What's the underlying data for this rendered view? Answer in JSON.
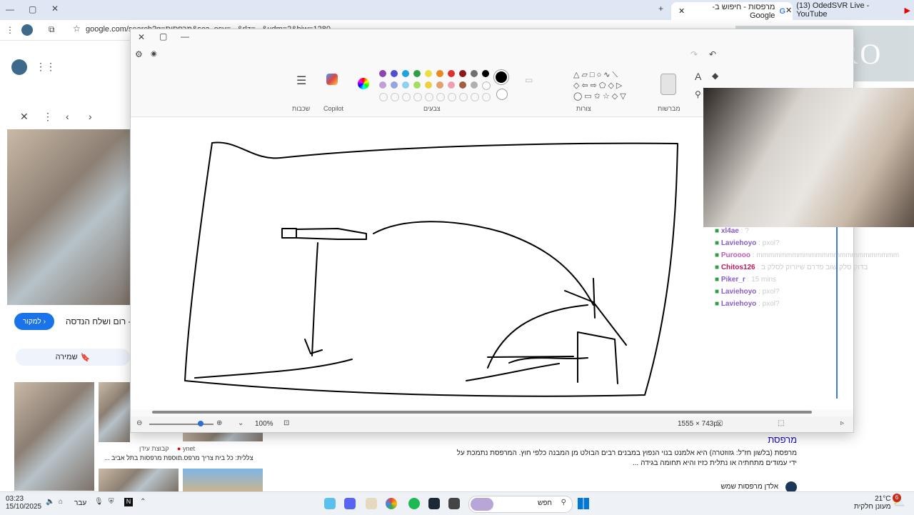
{
  "browser": {
    "tabs": [
      {
        "title": "(13) OdedSVR Live - YouTube"
      },
      {
        "title": "מרפסות - חיפוש ב-Google"
      }
    ],
    "url": "google.com/search?q=מרפסות&sca_esv=...&rlz=...&udm=2&biw=1280"
  },
  "google": {
    "source_button": "למקור",
    "result_title": "- רום ושלח הנדסה",
    "save_button": "שמירה",
    "thumb_captions": [
      {
        "source": "ynet",
        "caption": "צללית: כל בית צריך מרפס..."
      },
      {
        "source": "קבוצת עידן",
        "caption": "תוספת מרפסות בתל אביב ..."
      }
    ],
    "wiki_title": "מרפסת",
    "wiki_text_1": "מרפסת (בלשון חז\"ל: גזוזטרה) היא אלמנט בנוי הנפוץ במבנים רבים הבולט מן המבנה כלפי חוץ. המרפסת נתמכת על",
    "wiki_text_2": "ידי עמודים מתחתיה או נתלית כזיז והיא תחומה בגידה ...",
    "related": "אלדן מרפסות שמש"
  },
  "paint": {
    "groups": {
      "layers": "שכבות",
      "copilot": "Copilot",
      "colors": "צבעים",
      "shapes": "צורות",
      "brushes": "מברשות"
    },
    "zoom": "100%",
    "canvas_size": "1555 × 743px",
    "colors": {
      "row1": [
        "#8e44ad",
        "#5050d0",
        "#1fa3e0",
        "#2ea043",
        "#e8e040",
        "#e88a20",
        "#e03030",
        "#8b1a1a",
        "#707070",
        "#000000"
      ],
      "row2": [
        "#c0a0d8",
        "#98a4e0",
        "#8fd0f0",
        "#a7dd60",
        "#f0d040",
        "#e0a070",
        "#f0a0b0",
        "#a06040",
        "#b0b0b0",
        "#ffffff"
      ]
    }
  },
  "stream": {
    "banner": "LIBERO",
    "chat": [
      {
        "user": "xl4ae",
        "msg": ": ?",
        "color": "#8a5cc9"
      },
      {
        "user": "Laviehoyo",
        "msg": ": pxol?",
        "color": "#8a5cc9"
      },
      {
        "user": "Puroooo",
        "msg": ": mmmmmmmmmmmmmmmmmmmmmmmm",
        "color": "#c25bbf"
      },
      {
        "user": "Chitos126",
        "msg": ": בדוק סלק שוב פדרם שיזרוק לסלק ב",
        "color": "#c0195e"
      },
      {
        "user": "Piker_r",
        "msg": ": 15 mins",
        "color": "#8a5cc9"
      },
      {
        "user": "Laviehoyo",
        "msg": ": pxol?",
        "color": "#8a5cc9"
      },
      {
        "user": "Laviehoyo",
        "msg": ": pxol?",
        "color": "#8a5cc9"
      }
    ]
  },
  "taskbar": {
    "time": "03:23",
    "date": "15/10/2025",
    "lang": "עבר",
    "search": "חפש",
    "weather_temp": "21°C",
    "weather_desc": "מעונן חלקית",
    "badge": "6"
  }
}
